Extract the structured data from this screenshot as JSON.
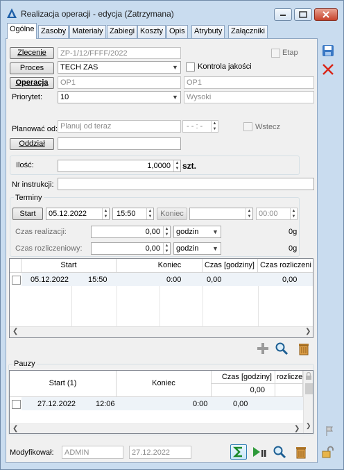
{
  "window": {
    "title": "Realizacja operacji - edycja (Zatrzymana)"
  },
  "tabs": [
    "Ogólne",
    "Zasoby",
    "Materiały",
    "Zabiegi",
    "Koszty",
    "Opis",
    "Atrybuty",
    "Załączniki"
  ],
  "form": {
    "zlecenie_label": "Zlecenie",
    "zlecenie_value": "ZP-1/12/FFFF/2022",
    "etap_label": "Etap",
    "proces_label": "Proces",
    "proces_value": "TECH ZAS",
    "kontrola_label": "Kontrola jakości",
    "operacja_label": "Operacja",
    "operacja_value": "OP1",
    "operacja_name": "OP1",
    "priorytet_label": "Priorytet:",
    "priorytet_value": "10",
    "priorytet_name": "Wysoki",
    "planowac_label": "Planować od:",
    "planowac_value": "Planuj od teraz",
    "planowac_time": "- - : -",
    "wstecz_label": "Wstecz",
    "oddzial_label": "Oddział",
    "oddzial_value": "",
    "ilosc_label": "Ilość:",
    "ilosc_value": "1,0000",
    "ilosc_unit": "szt.",
    "instrukcji_label": "Nr instrukcji:",
    "instrukcji_value": ""
  },
  "terminy": {
    "title": "Terminy",
    "start_label": "Start",
    "start_date": "05.12.2022",
    "start_time": "15:50",
    "koniec_label": "Koniec",
    "koniec_date": "",
    "koniec_time": "00:00",
    "czas_real_label": "Czas realizacji:",
    "czas_real_value": "0,00",
    "czas_real_unit": "godzin",
    "czas_real_right": "0g",
    "czas_rozl_label": "Czas rozliczeniowy:",
    "czas_rozl_value": "0,00",
    "czas_rozl_unit": "godzin",
    "czas_rozl_right": "0g"
  },
  "terminy_grid": {
    "headers": [
      "Start",
      "Koniec",
      "Czas [godziny]",
      "Czas rozliczeni"
    ],
    "rows": [
      {
        "start_date": "05.12.2022",
        "start_time": "15:50",
        "koniec": "0:00",
        "czas": "0,00",
        "czas_rozl": "0,00"
      }
    ]
  },
  "pauzy": {
    "title": "Pauzy",
    "headers": [
      "Start (1)",
      "Koniec",
      "Czas [godziny]",
      "rozlicze"
    ],
    "subtotal": "0,00",
    "rows": [
      {
        "start_date": "27.12.2022",
        "start_time": "12:06",
        "koniec": "0:00",
        "czas": "0,00"
      }
    ]
  },
  "footer": {
    "modyfikowal_label": "Modyfikował:",
    "modyfikowal_user": "ADMIN",
    "modyfikowal_date": "27.12.2022"
  },
  "colors": {
    "accent": "#2f7fb5",
    "window_bg": "#c9dcef",
    "panel_bg": "#f0f0f0",
    "delete": "#d8281b"
  }
}
